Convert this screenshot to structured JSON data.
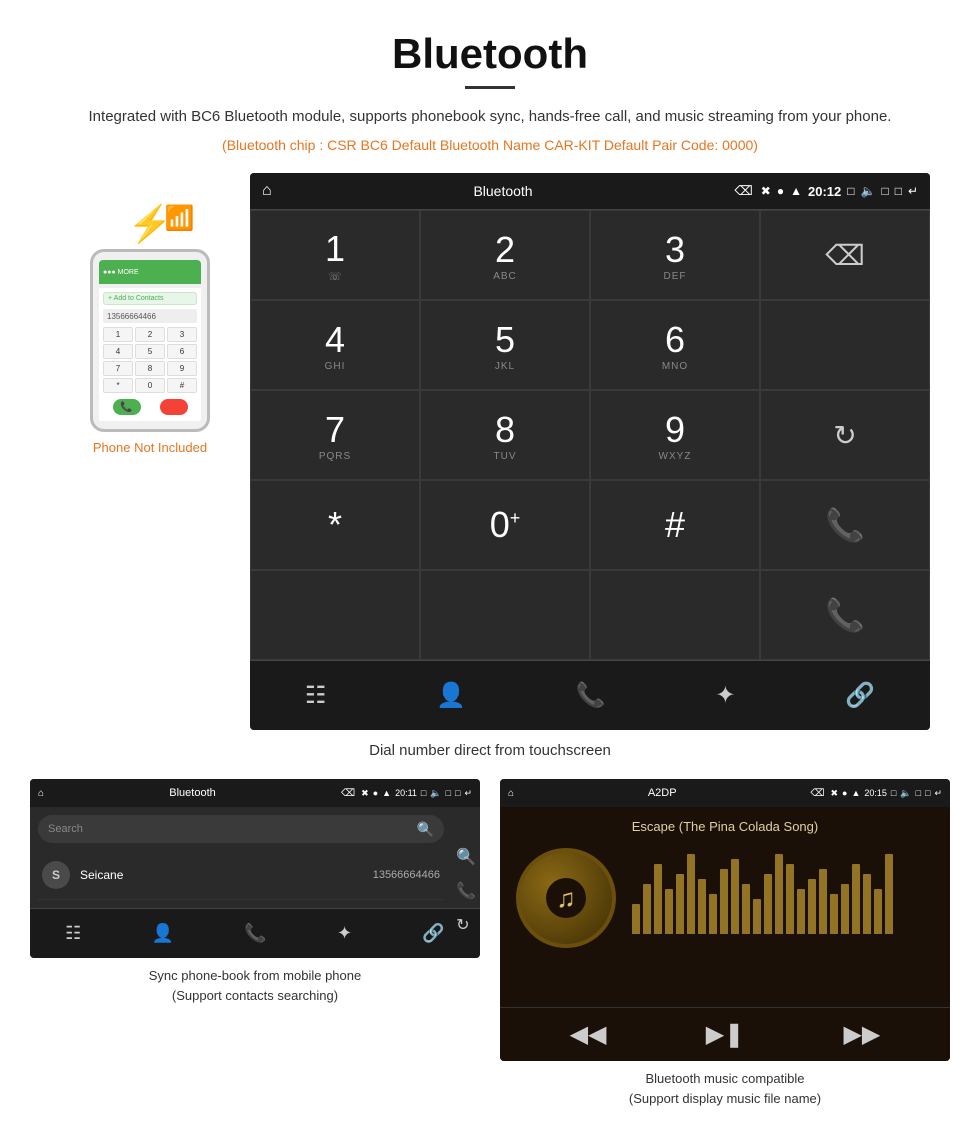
{
  "header": {
    "title": "Bluetooth",
    "subtitle": "Integrated with BC6 Bluetooth module, supports phonebook sync, hands-free call, and music streaming from your phone.",
    "spec_line": "(Bluetooth chip : CSR BC6    Default Bluetooth Name CAR-KIT    Default Pair Code: 0000)"
  },
  "phone_note": "Phone Not Included",
  "dial_screen": {
    "status_bar": {
      "title": "Bluetooth",
      "time": "20:12"
    },
    "keys": [
      {
        "number": "1",
        "letters": ""
      },
      {
        "number": "2",
        "letters": "ABC"
      },
      {
        "number": "3",
        "letters": "DEF"
      },
      {
        "number": "",
        "letters": ""
      },
      {
        "number": "4",
        "letters": "GHI"
      },
      {
        "number": "5",
        "letters": "JKL"
      },
      {
        "number": "6",
        "letters": "MNO"
      },
      {
        "number": "",
        "letters": ""
      },
      {
        "number": "7",
        "letters": "PQRS"
      },
      {
        "number": "8",
        "letters": "TUV"
      },
      {
        "number": "9",
        "letters": "WXYZ"
      },
      {
        "number": "",
        "letters": ""
      },
      {
        "number": "*",
        "letters": ""
      },
      {
        "number": "0",
        "letters": "+"
      },
      {
        "number": "#",
        "letters": ""
      }
    ]
  },
  "dial_caption": "Dial number direct from touchscreen",
  "phonebook_screen": {
    "status_bar": {
      "title": "Bluetooth",
      "time": "20:11"
    },
    "search_placeholder": "Search",
    "contacts": [
      {
        "initial": "S",
        "name": "Seicane",
        "number": "13566664466"
      }
    ]
  },
  "phonebook_caption": "Sync phone-book from mobile phone\n(Support contacts searching)",
  "music_screen": {
    "status_bar": {
      "title": "A2DP",
      "time": "20:15"
    },
    "song_title": "Escape (The Pina Colada Song)",
    "viz_bars": [
      30,
      50,
      70,
      45,
      60,
      80,
      55,
      40,
      65,
      75,
      50,
      35,
      60,
      80,
      70,
      45,
      55,
      65,
      40,
      50,
      70,
      60,
      45,
      80
    ]
  },
  "music_caption": "Bluetooth music compatible\n(Support display music file name)"
}
